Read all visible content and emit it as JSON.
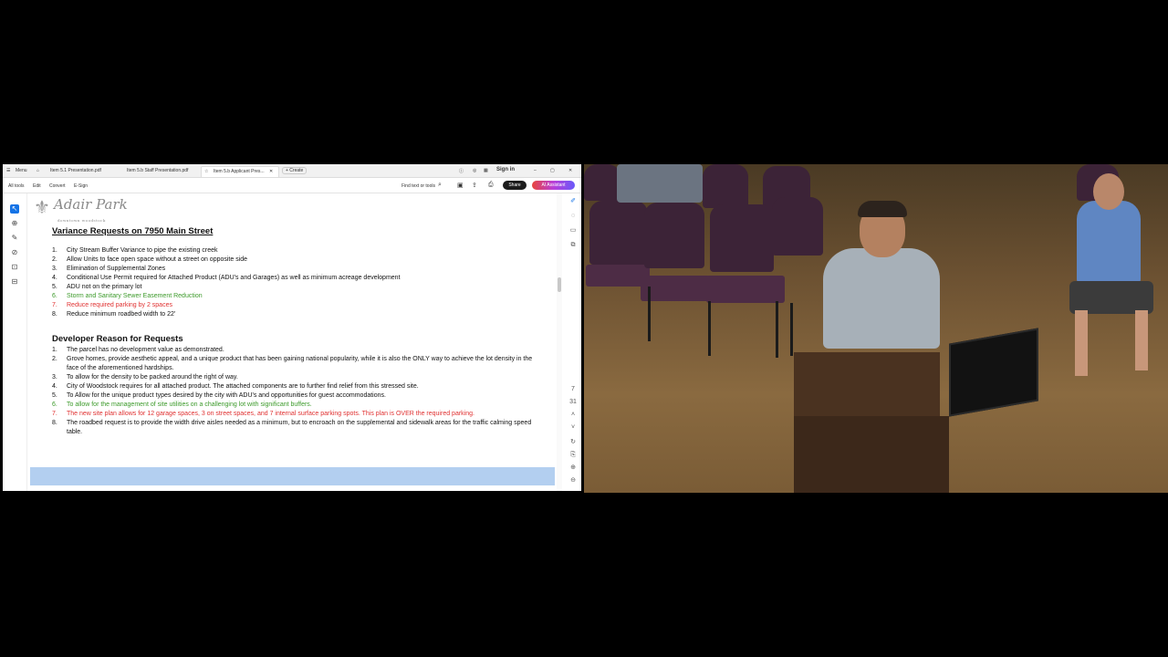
{
  "app": {
    "menu_label": "Menu",
    "tabs": [
      {
        "label": "Item 5.1 Presentation.pdf"
      },
      {
        "label": "Item 5.b Staff Presentation.pdf"
      },
      {
        "label": "Item 5.b Applicant Pres..."
      }
    ],
    "create_label": "+ Create",
    "sign_in": "Sign in"
  },
  "toolbar": {
    "all_tools": "All tools",
    "edit": "Edit",
    "convert": "Convert",
    "esign": "E-Sign",
    "find": "Find text or tools",
    "share": "Share",
    "ai_assistant": "AI Assistant"
  },
  "document": {
    "logo": {
      "name": "Adair Park",
      "tagline": "downtown woodstock"
    },
    "section1": {
      "title": "Variance Requests on 7950 Main Street",
      "items": [
        {
          "num": "1.",
          "text": "City Stream Buffer Variance to pipe the existing creek",
          "color": "#111111"
        },
        {
          "num": "2.",
          "text": "Allow Units to face open space without a street on opposite side",
          "color": "#111111"
        },
        {
          "num": "3.",
          "text": "Elimination of Supplemental Zones",
          "color": "#111111"
        },
        {
          "num": "4.",
          "text": "Conditional Use Permit required for Attached Product (ADU's and Garages) as well as minimum acreage development",
          "color": "#111111"
        },
        {
          "num": "5.",
          "text": "ADU not on the primary lot",
          "color": "#111111"
        },
        {
          "num": "6.",
          "text": "Storm and Sanitary Sewer Easement Reduction",
          "color": "#3c9a2a"
        },
        {
          "num": "7.",
          "text": "Reduce required parking by 2 spaces",
          "color": "#e03131"
        },
        {
          "num": "8.",
          "text": "Reduce minimum roadbed width to 22'",
          "color": "#111111"
        }
      ]
    },
    "section2": {
      "title": "Developer Reason for Requests",
      "items": [
        {
          "num": "1.",
          "text": "The parcel has no development value as demonstrated.",
          "color": "#111111"
        },
        {
          "num": "2.",
          "text": "Grove homes, provide aesthetic appeal, and a unique product that has been gaining national popularity, while it is also the ONLY way to achieve the lot density in the face of the aforementioned hardships.",
          "color": "#111111"
        },
        {
          "num": "3.",
          "text": "To allow for the density to be packed around the right of way.",
          "color": "#111111"
        },
        {
          "num": "4.",
          "text": "City of Woodstock requires for all attached product.  The attached components are to further find relief from this stressed site.",
          "color": "#111111"
        },
        {
          "num": "5.",
          "text": "To Allow for the unique product types desired by the city with ADU's and opportunities for guest accommodations.",
          "color": "#111111"
        },
        {
          "num": "6.",
          "text": "To allow for the management of site utilities on a challenging lot with significant buffers.",
          "color": "#3c9a2a"
        },
        {
          "num": "7.",
          "text": "The new site plan allows for 12 garage spaces, 3 on street spaces, and 7 internal surface parking spots. This plan is OVER the required parking.",
          "color": "#e03131"
        },
        {
          "num": "8.",
          "text": "The roadbed request is to provide the width drive aisles needed as a minimum, but to encroach on the supplemental and sidewalk areas for the traffic calming speed table.",
          "color": "#111111"
        }
      ]
    }
  },
  "icons": {
    "menu": "hamburger-icon",
    "home": "home-icon",
    "star": "star-icon",
    "close": "close-icon",
    "search": "search-icon",
    "print": "print-icon"
  },
  "colors": {
    "accent": "#1473e6",
    "highlight_bar": "#b3cff0",
    "green_text": "#3c9a2a",
    "red_text": "#e03131"
  }
}
